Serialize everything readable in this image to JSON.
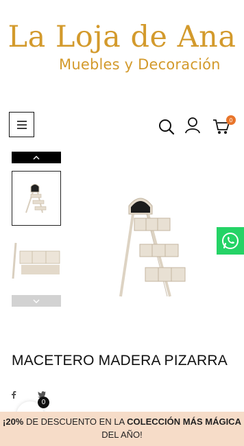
{
  "brand": {
    "title": "La Loja de Ana",
    "subtitle": "Muebles y Decoración"
  },
  "header": {
    "cart_count": "0",
    "icons": [
      "menu-icon",
      "search-icon",
      "user-icon",
      "cart-icon"
    ]
  },
  "product": {
    "title": "MACETERO MADERA PIZARRA"
  },
  "floating": {
    "count": "0"
  },
  "promo": {
    "part1": "¡20%",
    "part2": " DE DESCUENTO EN LA ",
    "part3": "COLECCIÓN MÁS MÁGICA",
    "part4": "DEL AÑO!"
  },
  "colors": {
    "brand": "#d39a2c",
    "badge": "#e8752b",
    "promo_bg": "#f6dcc8",
    "whatsapp": "#25d366"
  }
}
